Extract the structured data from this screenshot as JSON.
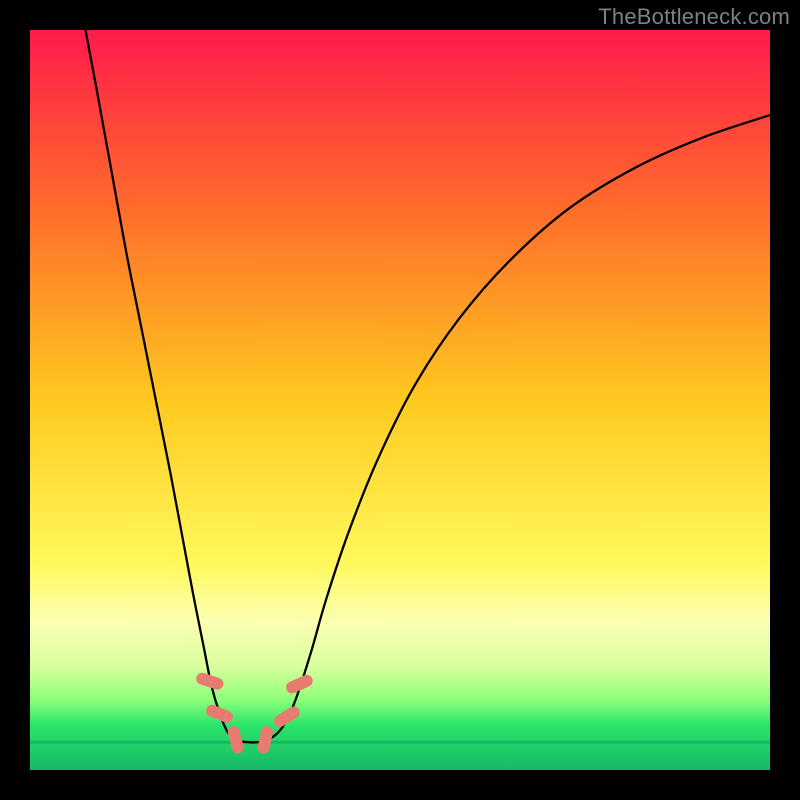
{
  "watermark": "TheBottleneck.com",
  "chart_data": {
    "type": "line",
    "title": "",
    "xlabel": "",
    "ylabel": "",
    "xlim": [
      0,
      100
    ],
    "ylim": [
      0,
      100
    ],
    "grid": false,
    "legend": false,
    "background_gradient": [
      {
        "offset": 0.0,
        "color": "#ff1a4b"
      },
      {
        "offset": 0.25,
        "color": "#ff6f2a"
      },
      {
        "offset": 0.5,
        "color": "#ffc91f"
      },
      {
        "offset": 0.72,
        "color": "#fff95b"
      },
      {
        "offset": 0.8,
        "color": "#fbffb2"
      },
      {
        "offset": 0.86,
        "color": "#d9ff9e"
      },
      {
        "offset": 0.905,
        "color": "#8dff7a"
      },
      {
        "offset": 0.94,
        "color": "#29e56a"
      },
      {
        "offset": 1.0,
        "color": "#16b865"
      }
    ],
    "series": [
      {
        "name": "bottleneck-curve",
        "color": "#000000",
        "points": [
          {
            "x": 7.5,
            "y": 100.0
          },
          {
            "x": 9.0,
            "y": 92.0
          },
          {
            "x": 11.0,
            "y": 81.0
          },
          {
            "x": 13.0,
            "y": 70.0
          },
          {
            "x": 15.0,
            "y": 60.0
          },
          {
            "x": 17.0,
            "y": 50.0
          },
          {
            "x": 19.0,
            "y": 40.0
          },
          {
            "x": 20.5,
            "y": 32.0
          },
          {
            "x": 22.0,
            "y": 24.0
          },
          {
            "x": 23.5,
            "y": 16.5
          },
          {
            "x": 24.5,
            "y": 11.5
          },
          {
            "x": 25.5,
            "y": 8.0
          },
          {
            "x": 26.5,
            "y": 5.5
          },
          {
            "x": 27.5,
            "y": 4.2
          },
          {
            "x": 29.0,
            "y": 3.8
          },
          {
            "x": 31.0,
            "y": 3.8
          },
          {
            "x": 33.0,
            "y": 4.6
          },
          {
            "x": 34.5,
            "y": 6.4
          },
          {
            "x": 36.0,
            "y": 9.8
          },
          {
            "x": 38.0,
            "y": 16.0
          },
          {
            "x": 40.0,
            "y": 23.0
          },
          {
            "x": 43.0,
            "y": 32.0
          },
          {
            "x": 47.0,
            "y": 42.0
          },
          {
            "x": 52.0,
            "y": 52.0
          },
          {
            "x": 58.0,
            "y": 61.0
          },
          {
            "x": 65.0,
            "y": 69.0
          },
          {
            "x": 73.0,
            "y": 76.0
          },
          {
            "x": 82.0,
            "y": 81.5
          },
          {
            "x": 91.0,
            "y": 85.5
          },
          {
            "x": 100.0,
            "y": 88.5
          }
        ]
      }
    ],
    "markers": [
      {
        "x": 24.3,
        "y": 12.0,
        "rotation": -72
      },
      {
        "x": 25.6,
        "y": 7.6,
        "rotation": -68
      },
      {
        "x": 27.8,
        "y": 4.1,
        "rotation": -15
      },
      {
        "x": 31.8,
        "y": 4.1,
        "rotation": 12
      },
      {
        "x": 34.7,
        "y": 7.2,
        "rotation": 58
      },
      {
        "x": 36.4,
        "y": 11.6,
        "rotation": 66
      }
    ],
    "baseline": {
      "y": 3.75,
      "color": "#17b566",
      "width": 3
    }
  }
}
